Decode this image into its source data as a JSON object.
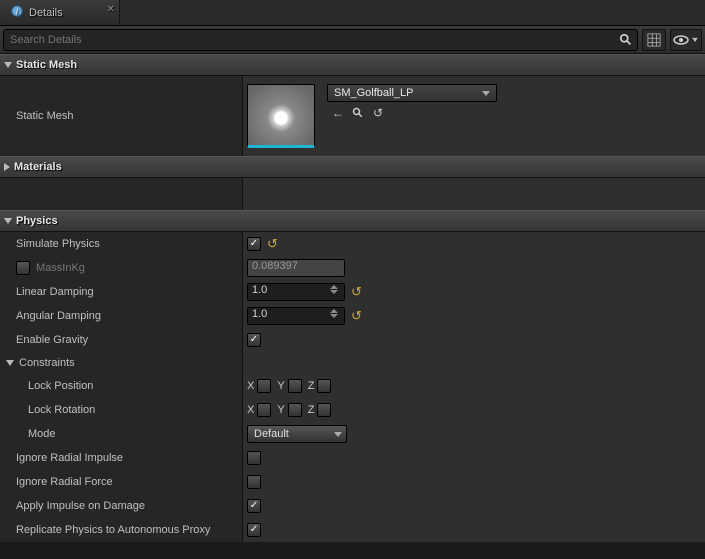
{
  "tab": {
    "title": "Details"
  },
  "search": {
    "placeholder": "Search Details"
  },
  "sections": {
    "static_mesh": {
      "title": "Static Mesh",
      "label": "Static Mesh",
      "asset": "SM_Golfball_LP"
    },
    "materials": {
      "title": "Materials"
    },
    "physics": {
      "title": "Physics",
      "simulate_physics": {
        "label": "Simulate Physics",
        "checked": true
      },
      "mass_in_kg": {
        "label": "MassInKg",
        "checked": false,
        "value": "0.089397"
      },
      "linear_damping": {
        "label": "Linear Damping",
        "value": "1.0"
      },
      "angular_damping": {
        "label": "Angular Damping",
        "value": "1.0"
      },
      "enable_gravity": {
        "label": "Enable Gravity",
        "checked": true
      },
      "constraints": {
        "title": "Constraints",
        "lock_position": {
          "label": "Lock Position",
          "x": "X",
          "y": "Y",
          "z": "Z"
        },
        "lock_rotation": {
          "label": "Lock Rotation",
          "x": "X",
          "y": "Y",
          "z": "Z"
        },
        "mode": {
          "label": "Mode",
          "value": "Default"
        }
      },
      "ignore_radial_impulse": {
        "label": "Ignore Radial Impulse",
        "checked": false
      },
      "ignore_radial_force": {
        "label": "Ignore Radial Force",
        "checked": false
      },
      "apply_impulse_on_damage": {
        "label": "Apply Impulse on Damage",
        "checked": true
      },
      "replicate_physics": {
        "label": "Replicate Physics to Autonomous Proxy",
        "checked": true
      }
    }
  }
}
